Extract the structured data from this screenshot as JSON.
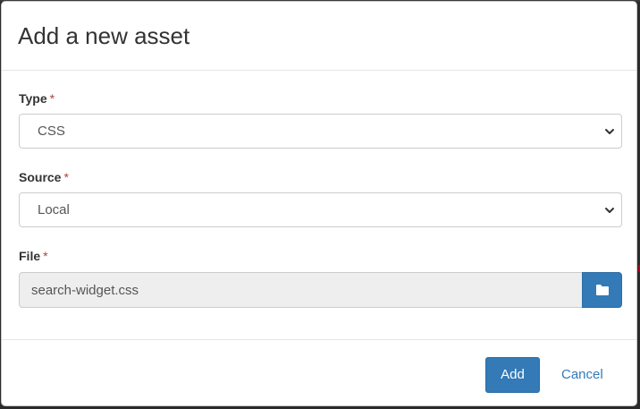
{
  "modal": {
    "title": "Add a new asset",
    "required_marker": "*",
    "type": {
      "label": "Type",
      "selected": "CSS"
    },
    "source": {
      "label": "Source",
      "selected": "Local"
    },
    "file": {
      "label": "File",
      "value": "search-widget.css"
    },
    "add_label": "Add",
    "cancel_label": "Cancel"
  },
  "icons": {
    "type_arrow": "chevron-down-icon",
    "source_arrow": "chevron-down-icon",
    "browse": "folder-icon"
  },
  "colors": {
    "primary": "#337ab7",
    "required": "#a94442",
    "readonly_bg": "#eeeeee"
  }
}
